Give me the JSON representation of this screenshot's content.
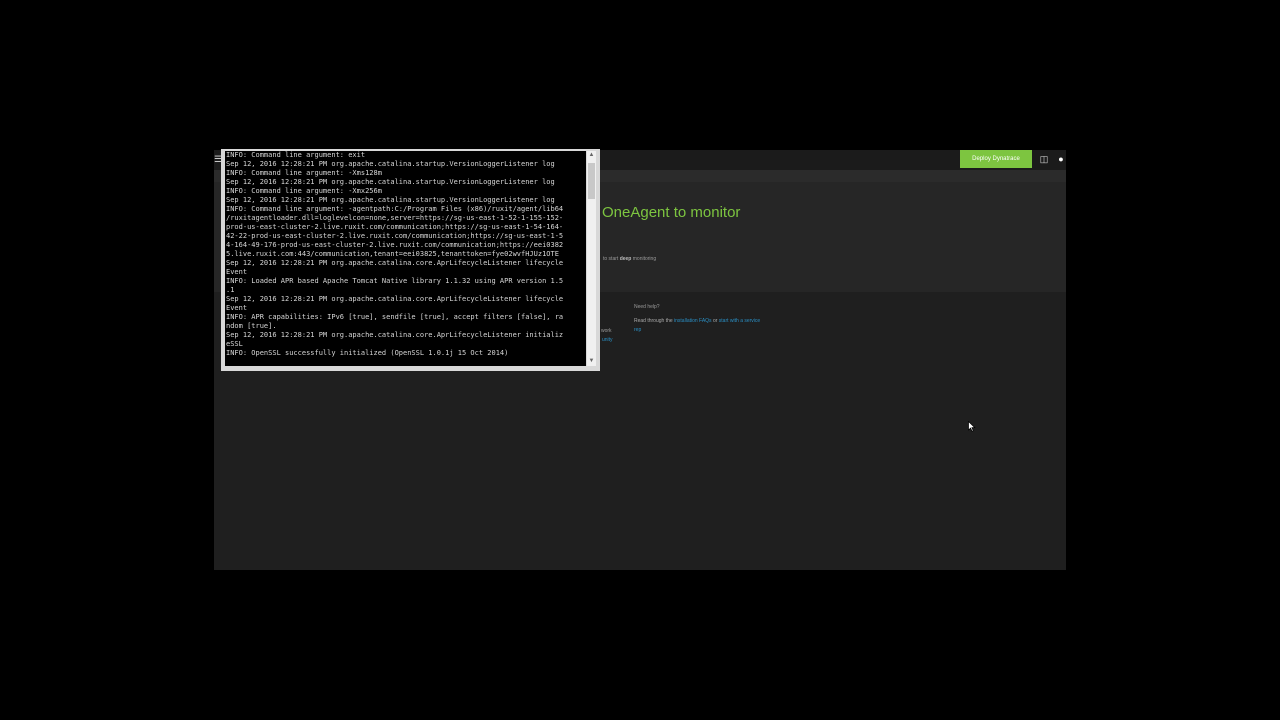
{
  "webapp": {
    "deploy_button": "Deploy Dynatrace",
    "hero_title": "OneAgent to monitor",
    "hero_subtitle_pre": "to start ",
    "hero_subtitle_bold": "deep",
    "hero_subtitle_post": " monitoring",
    "fragment_1": "work",
    "fragment_2": "unity",
    "help_heading": "Need help?",
    "help_text_pre": "Read through the ",
    "help_link_1": "installation FAQs",
    "help_text_mid": " or ",
    "help_link_2": "start with a service rep"
  },
  "icons": {
    "menu": "hamburger-menu-icon",
    "chat": "chat-icon",
    "user": "user-icon",
    "cursor": "mouse-pointer-icon"
  },
  "colors": {
    "accent": "#7dc540",
    "link": "#2a8fc4",
    "app_background": "#1f1f1f",
    "terminal_background": "#000000",
    "terminal_text": "#d6d6d6"
  },
  "terminal": {
    "lines": [
      "INFO: Command line argument: exit",
      "Sep 12, 2016 12:28:21 PM org.apache.catalina.startup.VersionLoggerListener log",
      "INFO: Command line argument: -Xms128m",
      "Sep 12, 2016 12:28:21 PM org.apache.catalina.startup.VersionLoggerListener log",
      "INFO: Command line argument: -Xmx256m",
      "Sep 12, 2016 12:28:21 PM org.apache.catalina.startup.VersionLoggerListener log",
      "INFO: Command line argument: -agentpath:C:/Program Files (x86)/ruxit/agent/lib64",
      "/ruxitagentloader.dll=loglevelcon=none,server=https://sg-us-east-1-52-1-155-152-",
      "prod-us-east-cluster-2.live.ruxit.com/communication;https://sg-us-east-1-54-164-",
      "42-22-prod-us-east-cluster-2.live.ruxit.com/communication;https://sg-us-east-1-5",
      "4-164-49-176-prod-us-east-cluster-2.live.ruxit.com/communication;https://eei0382",
      "5.live.ruxit.com:443/communication,tenant=eei03825,tenanttoken=fye02wvfHJUz1OTE",
      "Sep 12, 2016 12:28:21 PM org.apache.catalina.core.AprLifecycleListener lifecycle",
      "Event",
      "INFO: Loaded APR based Apache Tomcat Native library 1.1.32 using APR version 1.5",
      ".1",
      "Sep 12, 2016 12:28:21 PM org.apache.catalina.core.AprLifecycleListener lifecycle",
      "Event",
      "INFO: APR capabilities: IPv6 [true], sendfile [true], accept filters [false], ra",
      "ndom [true].",
      "Sep 12, 2016 12:28:21 PM org.apache.catalina.core.AprLifecycleListener initializ",
      "eSSL",
      "INFO: OpenSSL successfully initialized (OpenSSL 1.0.1j 15 Oct 2014)"
    ]
  }
}
